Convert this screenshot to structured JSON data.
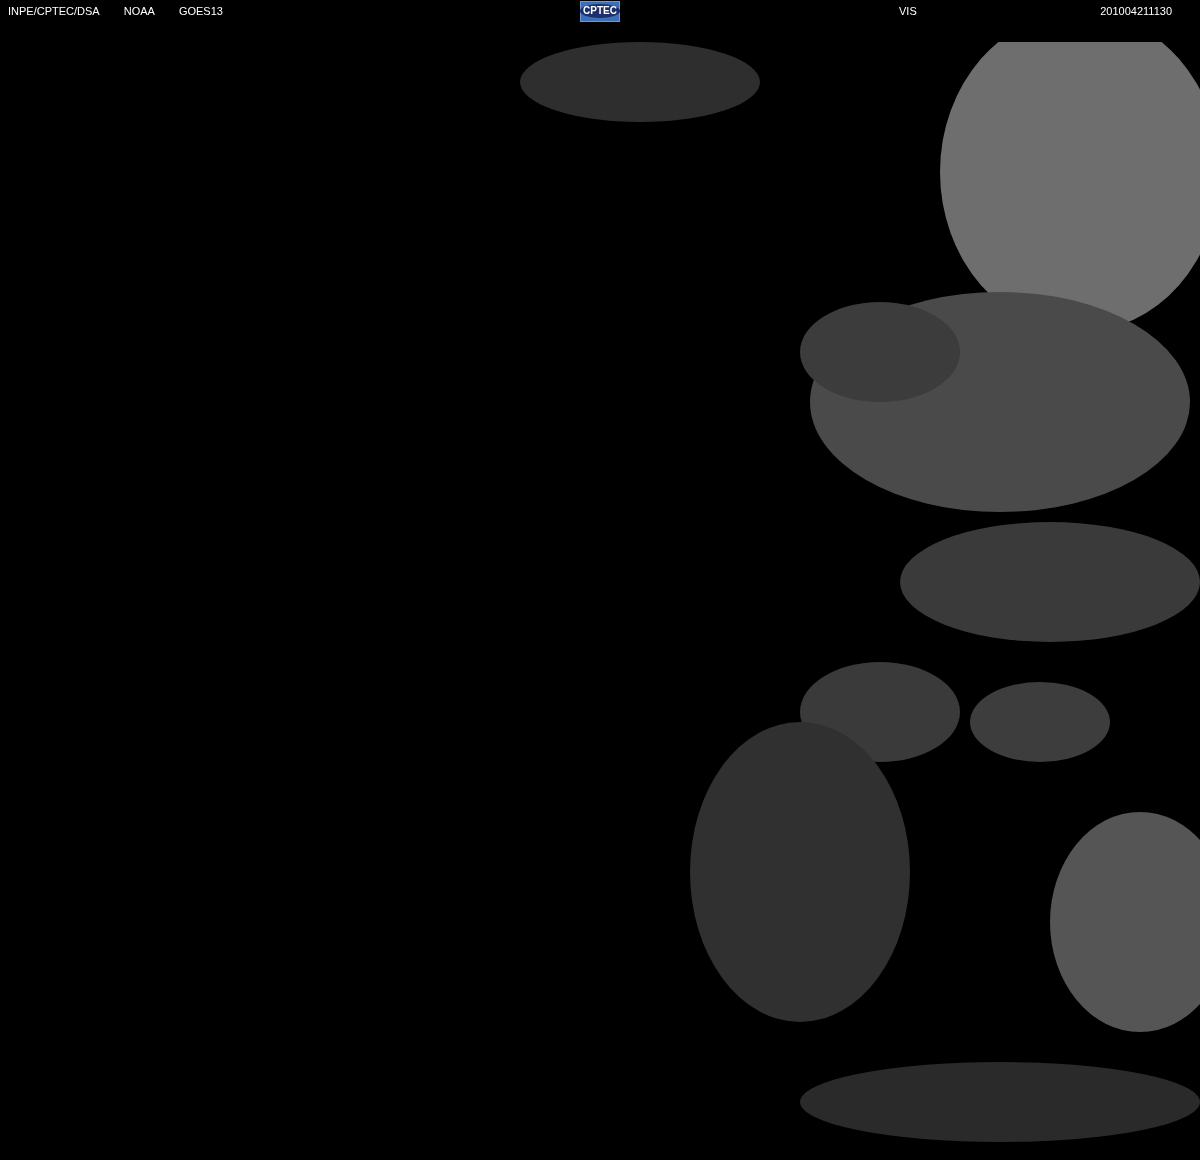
{
  "header": {
    "source": "INPE/CPTEC/DSA",
    "agency": "NOAA",
    "satellite": "GOES13",
    "logo": "CPTEC",
    "channel": "VIS",
    "timestamp": "201004211130"
  }
}
